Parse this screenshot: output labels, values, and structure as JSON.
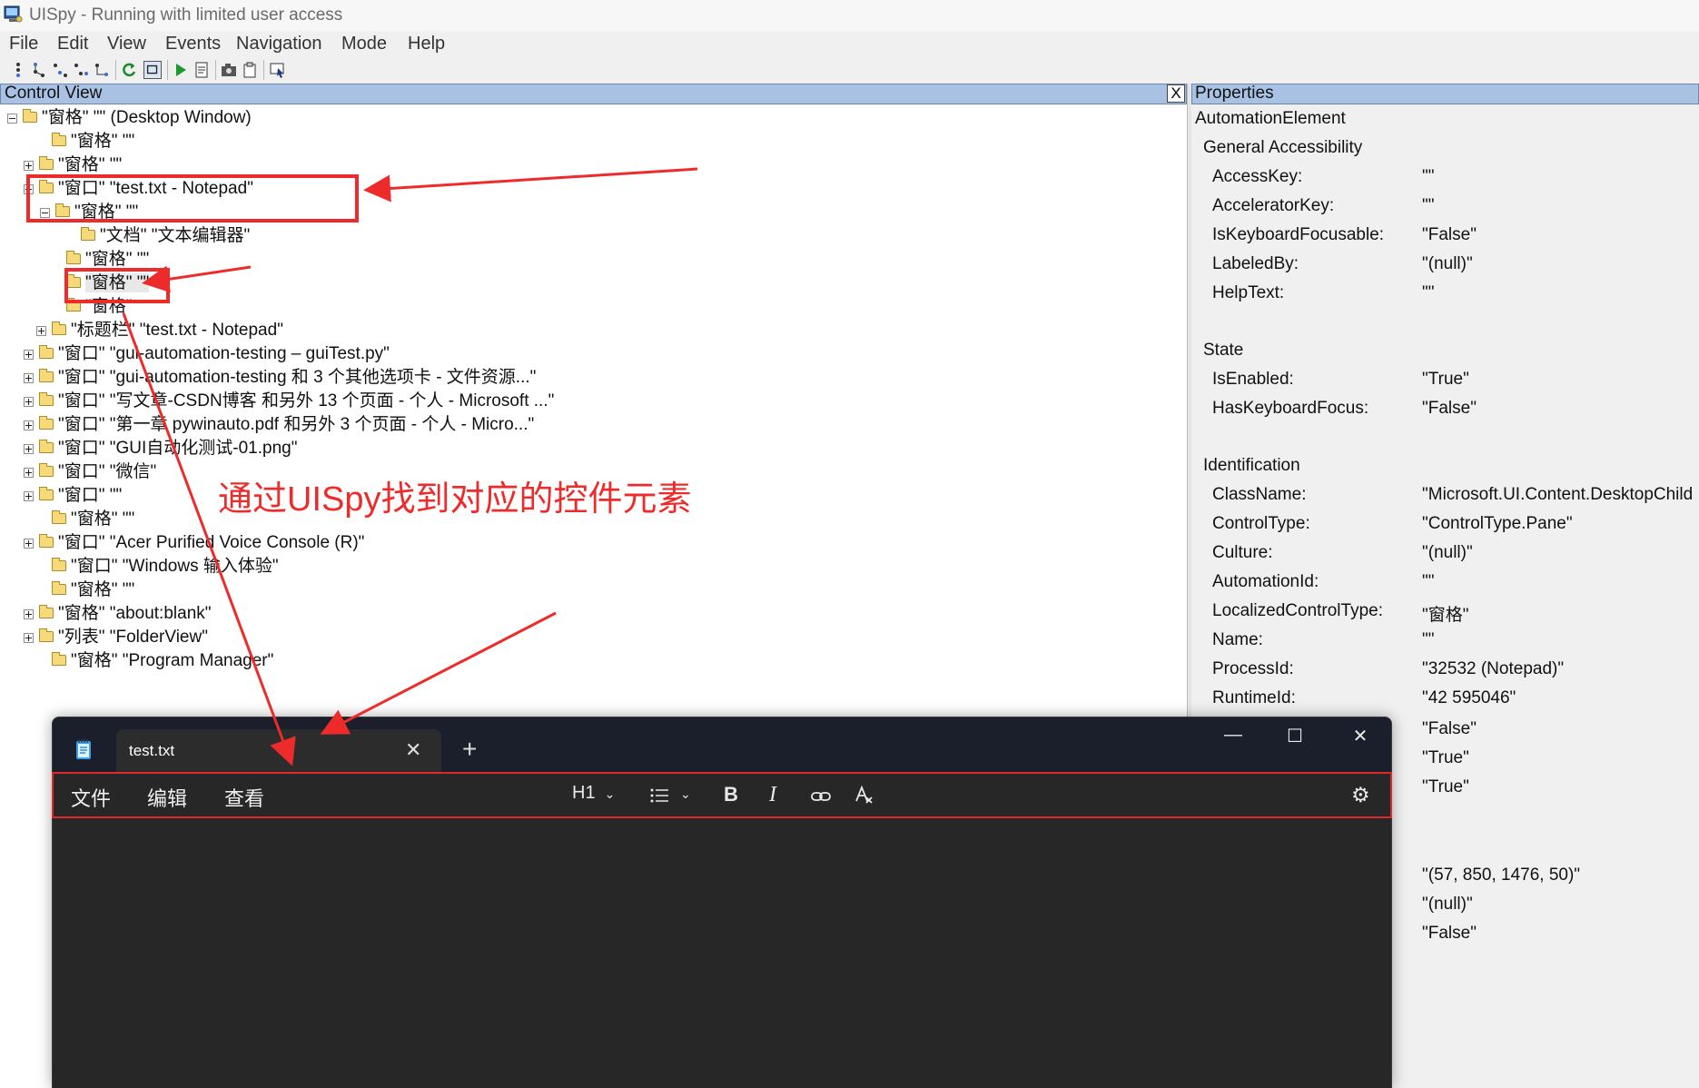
{
  "window": {
    "title": "UISpy - Running with limited user access"
  },
  "menu": [
    "File",
    "Edit",
    "View",
    "Events",
    "Navigation",
    "Mode",
    "Help"
  ],
  "toolbar_icons": [
    "tree-step-icon",
    "tree-parent-icon",
    "tree-first-child-icon",
    "tree-next-sibling-icon",
    "tree-last-icon",
    "refresh-icon",
    "highlight-rect-icon",
    "run-icon",
    "document-icon",
    "camera-icon",
    "clipboard-icon",
    "hover-mode-icon"
  ],
  "control_view": {
    "title": "Control View",
    "close": "X",
    "tree": [
      {
        "expander": "minus",
        "label": "\"窗格\" \"\" (Desktop Window)"
      },
      {
        "expander": "none",
        "label": "\"窗格\" \"\""
      },
      {
        "expander": "plus",
        "label": "\"窗格\" \"\""
      },
      {
        "expander": "minus",
        "label": "\"窗口\" \"test.txt - Notepad\""
      },
      {
        "expander": "minus",
        "label": "\"窗格\" \"\""
      },
      {
        "expander": "none",
        "label": "\"文档\" \"文本编辑器\""
      },
      {
        "expander": "none",
        "label": "\"窗格\" \"\""
      },
      {
        "expander": "none",
        "label": "\"窗格\" \"\""
      },
      {
        "expander": "none",
        "label": "\"窗格\""
      },
      {
        "expander": "plus",
        "label": "\"标题栏\" \"test.txt - Notepad\""
      },
      {
        "expander": "plus",
        "label": "\"窗口\" \"gui-automation-testing – guiTest.py\""
      },
      {
        "expander": "plus",
        "label": "\"窗口\" \"gui-automation-testing 和 3 个其他选项卡 - 文件资源...\""
      },
      {
        "expander": "plus",
        "label": "\"窗口\" \"写文章-CSDN博客 和另外 13 个页面 - 个人 - Microsoft ...\""
      },
      {
        "expander": "plus",
        "label": "\"窗口\" \"第一章 pywinauto.pdf 和另外 3 个页面 - 个人 - Micro...\""
      },
      {
        "expander": "plus",
        "label": "\"窗口\" \"GUI自动化测试-01.png\""
      },
      {
        "expander": "plus",
        "label": "\"窗口\" \"微信\""
      },
      {
        "expander": "plus",
        "label": "\"窗口\" \"\""
      },
      {
        "expander": "none",
        "label": "\"窗格\" \"\""
      },
      {
        "expander": "plus",
        "label": "\"窗口\" \"Acer Purified Voice Console (R)\""
      },
      {
        "expander": "none",
        "label": "\"窗口\" \"Windows 输入体验\""
      },
      {
        "expander": "none",
        "label": "\"窗格\" \"\""
      },
      {
        "expander": "plus",
        "label": "\"窗格\" \"about:blank\""
      },
      {
        "expander": "plus",
        "label": "\"列表\" \"FolderView\""
      },
      {
        "expander": "none",
        "label": "\"窗格\" \"Program Manager\""
      }
    ]
  },
  "annotation": "通过UISpy找到对应的控件元素",
  "properties": {
    "title": "Properties",
    "root": "AutomationElement",
    "sections": [
      {
        "name": "General Accessibility",
        "rows": [
          {
            "key": "AccessKey:",
            "value": "\"\""
          },
          {
            "key": "AcceleratorKey:",
            "value": "\"\""
          },
          {
            "key": "IsKeyboardFocusable:",
            "value": "\"False\""
          },
          {
            "key": "LabeledBy:",
            "value": "\"(null)\""
          },
          {
            "key": "HelpText:",
            "value": "\"\""
          }
        ]
      },
      {
        "name": "State",
        "rows": [
          {
            "key": "IsEnabled:",
            "value": "\"True\""
          },
          {
            "key": "HasKeyboardFocus:",
            "value": "\"False\""
          }
        ]
      },
      {
        "name": "Identification",
        "rows": [
          {
            "key": "ClassName:",
            "value": "\"Microsoft.UI.Content.DesktopChild"
          },
          {
            "key": "ControlType:",
            "value": "\"ControlType.Pane\""
          },
          {
            "key": "Culture:",
            "value": "\"(null)\""
          },
          {
            "key": "AutomationId:",
            "value": "\"\""
          },
          {
            "key": "LocalizedControlType:",
            "value": "\"窗格\""
          },
          {
            "key": "Name:",
            "value": "\"\""
          },
          {
            "key": "ProcessId:",
            "value": "\"32532 (Notepad)\""
          },
          {
            "key": "RuntimeId:",
            "value": "\"42 595046\""
          }
        ]
      }
    ],
    "extra_values": [
      "\"False\"",
      "\"True\"",
      "\"True\"",
      "\"(57, 850, 1476, 50)\"",
      "\"(null)\"",
      "\"False\""
    ]
  },
  "notepad": {
    "tab_label": "test.txt",
    "tab_close": "✕",
    "new_tab": "+",
    "win_minimize": "—",
    "win_maximize": "☐",
    "win_close": "✕",
    "menus": [
      "文件",
      "编辑",
      "查看"
    ],
    "heading": "H1",
    "bold": "B",
    "italic": "I",
    "gear": "⚙"
  }
}
